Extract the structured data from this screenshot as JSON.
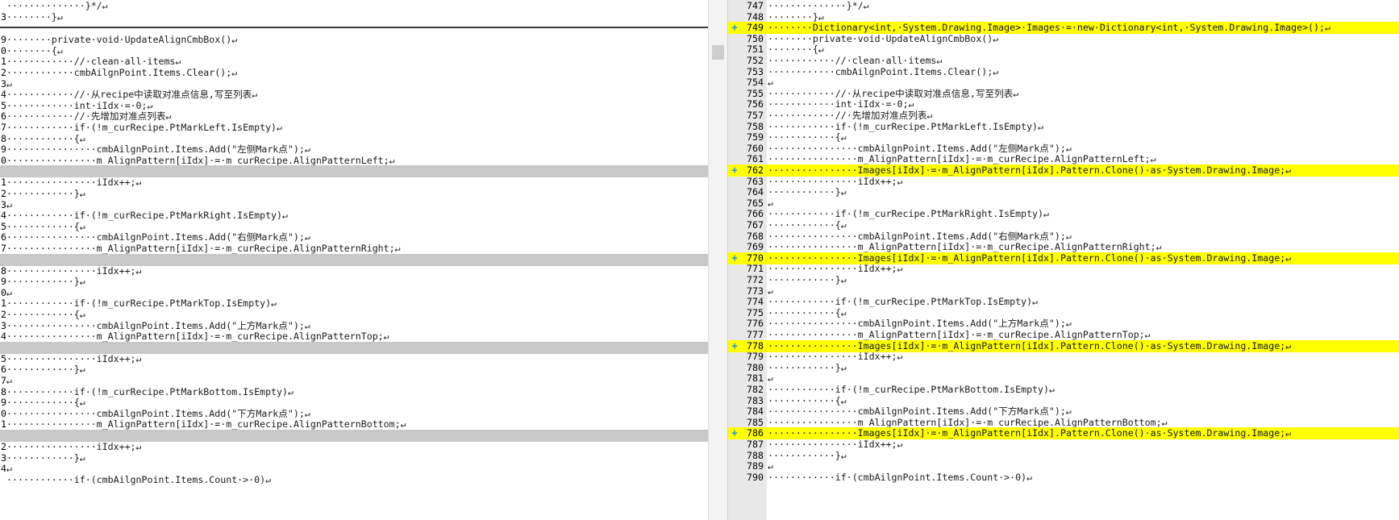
{
  "left_pane": {
    "lines": [
      {
        "num": "",
        "text": "··············}*/↵",
        "type": "normal"
      },
      {
        "num": "3",
        "text": "········}↵",
        "type": "normal"
      },
      {
        "num": "",
        "text": "",
        "type": "sep"
      },
      {
        "num": "9",
        "text": "········private·void·UpdateAlignCmbBox()↵",
        "type": "normal"
      },
      {
        "num": "0",
        "text": "········{↵",
        "type": "normal"
      },
      {
        "num": "1",
        "text": "············//·clean·all·items↵",
        "type": "normal"
      },
      {
        "num": "2",
        "text": "············cmbAilgnPoint.Items.Clear();↵",
        "type": "normal"
      },
      {
        "num": "3",
        "text": "↵",
        "type": "normal"
      },
      {
        "num": "4",
        "text": "············//·从recipe中读取对准点信息,写至列表↵",
        "type": "normal"
      },
      {
        "num": "5",
        "text": "············int·iIdx·=·0;↵",
        "type": "normal"
      },
      {
        "num": "6",
        "text": "············//·先增加对准点列表↵",
        "type": "normal"
      },
      {
        "num": "7",
        "text": "············if·(!m_curRecipe.PtMarkLeft.IsEmpty)↵",
        "type": "normal"
      },
      {
        "num": "8",
        "text": "············{↵",
        "type": "normal"
      },
      {
        "num": "9",
        "text": "················cmbAilgnPoint.Items.Add(\"左侧Mark点\");↵",
        "type": "normal"
      },
      {
        "num": "0",
        "text": "················m_AlignPattern[iIdx]·=·m_curRecipe.AlignPatternLeft;↵",
        "type": "normal"
      },
      {
        "num": "",
        "text": "",
        "type": "gap"
      },
      {
        "num": "1",
        "text": "················iIdx++;↵",
        "type": "normal"
      },
      {
        "num": "2",
        "text": "············}↵",
        "type": "normal"
      },
      {
        "num": "3",
        "text": "↵",
        "type": "normal"
      },
      {
        "num": "4",
        "text": "············if·(!m_curRecipe.PtMarkRight.IsEmpty)↵",
        "type": "normal"
      },
      {
        "num": "5",
        "text": "············{↵",
        "type": "normal"
      },
      {
        "num": "6",
        "text": "················cmbAilgnPoint.Items.Add(\"右侧Mark点\");↵",
        "type": "normal"
      },
      {
        "num": "7",
        "text": "················m_AlignPattern[iIdx]·=·m_curRecipe.AlignPatternRight;↵",
        "type": "normal"
      },
      {
        "num": "",
        "text": "",
        "type": "gap"
      },
      {
        "num": "8",
        "text": "················iIdx++;↵",
        "type": "normal"
      },
      {
        "num": "9",
        "text": "············}↵",
        "type": "normal"
      },
      {
        "num": "0",
        "text": "↵",
        "type": "normal"
      },
      {
        "num": "1",
        "text": "············if·(!m_curRecipe.PtMarkTop.IsEmpty)↵",
        "type": "normal"
      },
      {
        "num": "2",
        "text": "············{↵",
        "type": "normal"
      },
      {
        "num": "3",
        "text": "················cmbAilgnPoint.Items.Add(\"上方Mark点\");↵",
        "type": "normal"
      },
      {
        "num": "4",
        "text": "················m_AlignPattern[iIdx]·=·m_curRecipe.AlignPatternTop;↵",
        "type": "normal"
      },
      {
        "num": "",
        "text": "",
        "type": "gap"
      },
      {
        "num": "5",
        "text": "················iIdx++;↵",
        "type": "normal"
      },
      {
        "num": "6",
        "text": "············}↵",
        "type": "normal"
      },
      {
        "num": "7",
        "text": "↵",
        "type": "normal"
      },
      {
        "num": "8",
        "text": "············if·(!m_curRecipe.PtMarkBottom.IsEmpty)↵",
        "type": "normal"
      },
      {
        "num": "9",
        "text": "············{↵",
        "type": "normal"
      },
      {
        "num": "0",
        "text": "················cmbAilgnPoint.Items.Add(\"下方Mark点\");↵",
        "type": "normal"
      },
      {
        "num": "1",
        "text": "················m_AlignPattern[iIdx]·=·m_curRecipe.AlignPatternBottom;↵",
        "type": "normal"
      },
      {
        "num": "",
        "text": "",
        "type": "gap"
      },
      {
        "num": "2",
        "text": "················iIdx++;↵",
        "type": "normal"
      },
      {
        "num": "3",
        "text": "············}↵",
        "type": "normal"
      },
      {
        "num": "4",
        "text": "↵",
        "type": "normal"
      },
      {
        "num": "",
        "text": "············if·(cmbAilgnPoint.Items.Count·>·0)↵",
        "type": "normal"
      }
    ]
  },
  "right_pane": {
    "lines": [
      {
        "num": "747",
        "text": "··············}*/↵",
        "type": "normal",
        "marker": ""
      },
      {
        "num": "748",
        "text": "········}↵",
        "type": "normal",
        "marker": ""
      },
      {
        "num": "749",
        "text": "········Dictionary<int,·System.Drawing.Image>·Images·=·new·Dictionary<int,·System.Drawing.Image>();↵",
        "type": "added",
        "marker": "+"
      },
      {
        "num": "750",
        "text": "········private·void·UpdateAlignCmbBox()↵",
        "type": "normal",
        "marker": ""
      },
      {
        "num": "751",
        "text": "········{↵",
        "type": "normal",
        "marker": ""
      },
      {
        "num": "752",
        "text": "············//·clean·all·items↵",
        "type": "normal",
        "marker": ""
      },
      {
        "num": "753",
        "text": "············cmbAilgnPoint.Items.Clear();↵",
        "type": "normal",
        "marker": ""
      },
      {
        "num": "754",
        "text": "↵",
        "type": "normal",
        "marker": ""
      },
      {
        "num": "755",
        "text": "············//·从recipe中读取对准点信息,写至列表↵",
        "type": "normal",
        "marker": ""
      },
      {
        "num": "756",
        "text": "············int·iIdx·=·0;↵",
        "type": "normal",
        "marker": ""
      },
      {
        "num": "757",
        "text": "············//·先增加对准点列表↵",
        "type": "normal",
        "marker": ""
      },
      {
        "num": "758",
        "text": "············if·(!m_curRecipe.PtMarkLeft.IsEmpty)↵",
        "type": "normal",
        "marker": ""
      },
      {
        "num": "759",
        "text": "············{↵",
        "type": "normal",
        "marker": ""
      },
      {
        "num": "760",
        "text": "················cmbAilgnPoint.Items.Add(\"左侧Mark点\");↵",
        "type": "normal",
        "marker": ""
      },
      {
        "num": "761",
        "text": "················m_AlignPattern[iIdx]·=·m_curRecipe.AlignPatternLeft;↵",
        "type": "normal",
        "marker": ""
      },
      {
        "num": "762",
        "text": "················Images[iIdx]·=·m_AlignPattern[iIdx].Pattern.Clone()·as·System.Drawing.Image;↵",
        "type": "added",
        "marker": "+"
      },
      {
        "num": "763",
        "text": "················iIdx++;↵",
        "type": "normal",
        "marker": ""
      },
      {
        "num": "764",
        "text": "············}↵",
        "type": "normal",
        "marker": ""
      },
      {
        "num": "765",
        "text": "↵",
        "type": "normal",
        "marker": ""
      },
      {
        "num": "766",
        "text": "············if·(!m_curRecipe.PtMarkRight.IsEmpty)↵",
        "type": "normal",
        "marker": ""
      },
      {
        "num": "767",
        "text": "············{↵",
        "type": "normal",
        "marker": ""
      },
      {
        "num": "768",
        "text": "················cmbAilgnPoint.Items.Add(\"右侧Mark点\");↵",
        "type": "normal",
        "marker": ""
      },
      {
        "num": "769",
        "text": "················m_AlignPattern[iIdx]·=·m_curRecipe.AlignPatternRight;↵",
        "type": "normal",
        "marker": ""
      },
      {
        "num": "770",
        "text": "················Images[iIdx]·=·m_AlignPattern[iIdx].Pattern.Clone()·as·System.Drawing.Image;↵",
        "type": "added",
        "marker": "+"
      },
      {
        "num": "771",
        "text": "················iIdx++;↵",
        "type": "normal",
        "marker": ""
      },
      {
        "num": "772",
        "text": "············}↵",
        "type": "normal",
        "marker": ""
      },
      {
        "num": "773",
        "text": "↵",
        "type": "normal",
        "marker": ""
      },
      {
        "num": "774",
        "text": "············if·(!m_curRecipe.PtMarkTop.IsEmpty)↵",
        "type": "normal",
        "marker": ""
      },
      {
        "num": "775",
        "text": "············{↵",
        "type": "normal",
        "marker": ""
      },
      {
        "num": "776",
        "text": "················cmbAilgnPoint.Items.Add(\"上方Mark点\");↵",
        "type": "normal",
        "marker": ""
      },
      {
        "num": "777",
        "text": "················m_AlignPattern[iIdx]·=·m_curRecipe.AlignPatternTop;↵",
        "type": "normal",
        "marker": ""
      },
      {
        "num": "778",
        "text": "················Images[iIdx]·=·m_AlignPattern[iIdx].Pattern.Clone()·as·System.Drawing.Image;↵",
        "type": "added",
        "marker": "+"
      },
      {
        "num": "779",
        "text": "················iIdx++;↵",
        "type": "normal",
        "marker": ""
      },
      {
        "num": "780",
        "text": "············}↵",
        "type": "normal",
        "marker": ""
      },
      {
        "num": "781",
        "text": "↵",
        "type": "normal",
        "marker": ""
      },
      {
        "num": "782",
        "text": "············if·(!m_curRecipe.PtMarkBottom.IsEmpty)↵",
        "type": "normal",
        "marker": ""
      },
      {
        "num": "783",
        "text": "············{↵",
        "type": "normal",
        "marker": ""
      },
      {
        "num": "784",
        "text": "················cmbAilgnPoint.Items.Add(\"下方Mark点\");↵",
        "type": "normal",
        "marker": ""
      },
      {
        "num": "785",
        "text": "················m_AlignPattern[iIdx]·=·m_curRecipe.AlignPatternBottom;↵",
        "type": "normal",
        "marker": ""
      },
      {
        "num": "786",
        "text": "················Images[iIdx]·=·m_AlignPattern[iIdx].Pattern.Clone()·as·System.Drawing.Image;↵",
        "type": "added",
        "marker": "+"
      },
      {
        "num": "787",
        "text": "················iIdx++;↵",
        "type": "normal",
        "marker": ""
      },
      {
        "num": "788",
        "text": "············}↵",
        "type": "normal",
        "marker": ""
      },
      {
        "num": "789",
        "text": "↵",
        "type": "normal",
        "marker": ""
      },
      {
        "num": "790",
        "text": "············if·(cmbAilgnPoint.Items.Count·>·0)↵",
        "type": "normal",
        "marker": ""
      }
    ]
  },
  "colors": {
    "added_highlight": "#ffff00",
    "gap_fill": "#c8c8c8",
    "added_marker": "#1f8fc9"
  },
  "icons": {
    "added_marker": "plus-icon"
  }
}
